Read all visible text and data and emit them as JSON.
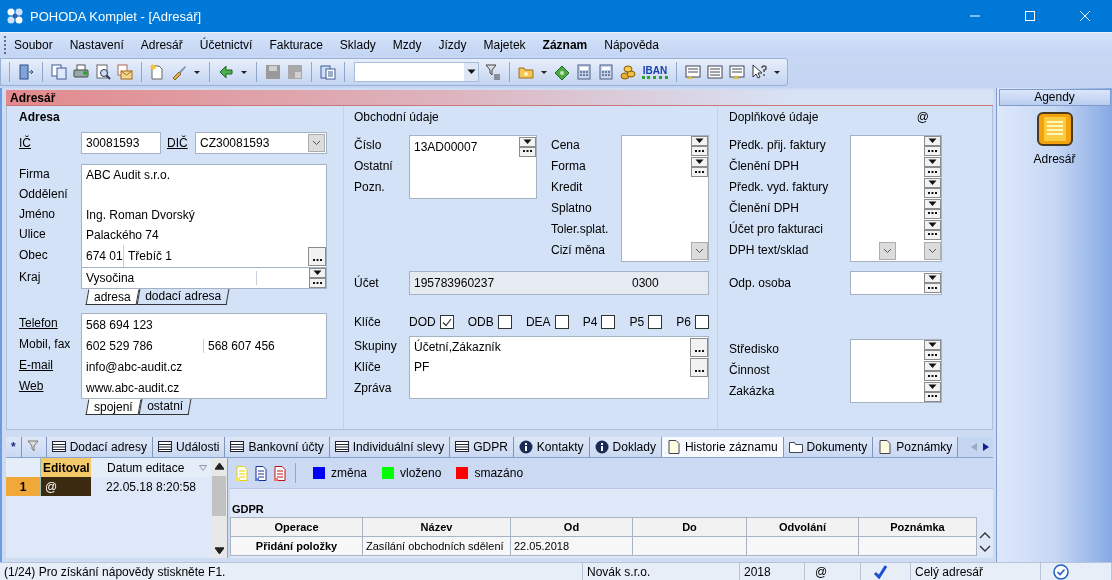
{
  "window": {
    "title": "POHODA Komplet - [Adresář]"
  },
  "menu": [
    {
      "label": "Soubor",
      "bold": false
    },
    {
      "label": "Nastavení",
      "bold": false
    },
    {
      "label": "Adresář",
      "bold": false
    },
    {
      "label": "Účetnictví",
      "bold": false
    },
    {
      "label": "Fakturace",
      "bold": false
    },
    {
      "label": "Sklady",
      "bold": false
    },
    {
      "label": "Mzdy",
      "bold": false
    },
    {
      "label": "Jízdy",
      "bold": false
    },
    {
      "label": "Majetek",
      "bold": false
    },
    {
      "label": "Záznam",
      "bold": true
    },
    {
      "label": "Nápověda",
      "bold": false
    }
  ],
  "toolbar": {
    "iban_label": "IBAN"
  },
  "agenda": {
    "title": "Adresář"
  },
  "address": {
    "title": "Adresa",
    "ic_label": "IČ",
    "ic": "30081593",
    "dic_label": "DIČ",
    "dic": "CZ30081593",
    "rows": [
      {
        "label": "Firma",
        "value": "ABC Audit s.r.o."
      },
      {
        "label": "Oddělení"
      },
      {
        "label": "Jméno",
        "value": "Ing. Roman Dvorský"
      },
      {
        "label": "Ulice",
        "value": "Palackého 74"
      }
    ],
    "city": {
      "label": "Obec",
      "zip": "674 01",
      "value": "Třebíč 1"
    },
    "region": {
      "label": "Kraj",
      "value": "Vysočina"
    },
    "tabs": [
      {
        "label": "adresa",
        "selected": true
      },
      {
        "label": "dodací adresa",
        "selected": false
      }
    ],
    "contact_rows": [
      {
        "label": "Telefon",
        "underlined": true,
        "value": "568 694 123"
      },
      {
        "label": "Mobil, fax",
        "underlined": false,
        "value": "602 529 786",
        "value_2": "568 607 456"
      },
      {
        "label": "E-mail",
        "underlined": true,
        "value": "info@abc-audit.cz"
      },
      {
        "label": "Web",
        "underlined": true,
        "value": "www.abc-audit.cz"
      }
    ],
    "contact_tabs": [
      {
        "label": "spojení",
        "selected": true
      },
      {
        "label": "ostatní",
        "selected": false
      }
    ]
  },
  "business": {
    "title": "Obchodní údaje",
    "number_labels": [
      "Číslo",
      "Ostatní",
      "Pozn."
    ],
    "number": "13AD00007",
    "price_labels": [
      "Cena",
      "Forma",
      "Kredit",
      "Splatno",
      "Toler.splat.",
      "Cizí měna"
    ],
    "account_label": "Účet",
    "account": "195783960237",
    "bank_code": "0300",
    "keys_label": "Klíče",
    "checks": [
      {
        "label": "DOD",
        "checked": true
      },
      {
        "label": "ODB",
        "checked": false
      },
      {
        "label": "DEA",
        "checked": false
      },
      {
        "label": "P4",
        "checked": false
      },
      {
        "label": "P5",
        "checked": false
      },
      {
        "label": "P6",
        "checked": false
      }
    ],
    "group_rows": [
      {
        "label": "Skupiny",
        "value": "Účetní,Zákazník"
      },
      {
        "label": "Klíče",
        "value": "PF"
      },
      {
        "label": "Zpráva"
      }
    ]
  },
  "extra": {
    "title": "Doplňkové údaje",
    "at": "@",
    "rows": [
      "Předk. přij. faktury",
      "Členění DPH",
      "Předk. vyd. faktury",
      "Členění DPH",
      "Účet pro fakturaci",
      "DPH text/sklad"
    ],
    "person_label": "Odp. osoba",
    "centre_labels": [
      "Středisko",
      "Činnost",
      "Zakázka"
    ]
  },
  "agendy": {
    "title": "Agendy",
    "items": [
      {
        "label": "Adresář"
      }
    ]
  },
  "tabs": [
    {
      "kind": "star",
      "label": "*",
      "selected": false
    },
    {
      "kind": "filter",
      "selected": false
    },
    {
      "kind": "table",
      "label": "Dodací adresy",
      "selected": false
    },
    {
      "kind": "table",
      "label": "Události",
      "selected": false
    },
    {
      "kind": "table",
      "label": "Bankovní účty",
      "selected": false
    },
    {
      "kind": "table",
      "label": "Individuální slevy",
      "selected": false
    },
    {
      "kind": "table",
      "label": "GDPR",
      "selected": false
    },
    {
      "kind": "info",
      "label": "Kontakty",
      "selected": false
    },
    {
      "kind": "info",
      "label": "Doklady",
      "selected": false
    },
    {
      "kind": "page",
      "label": "Historie záznamu",
      "selected": true
    },
    {
      "kind": "folder",
      "label": "Dokumenty",
      "selected": false
    },
    {
      "kind": "page",
      "label": "Poznámky",
      "selected": false
    }
  ],
  "history": {
    "legend": [
      {
        "label": "změna",
        "color": "#0000ff"
      },
      {
        "label": "vloženo",
        "color": "#00ff00"
      },
      {
        "label": "smazáno",
        "color": "#ff0000"
      }
    ],
    "list": {
      "columns": [
        "Editoval",
        "Datum editace"
      ],
      "rows": [
        {
          "number": "1",
          "selected": true,
          "user": "@",
          "date": "22.05.18 8:20:58"
        }
      ]
    },
    "detail": {
      "title": "GDPR",
      "columns": [
        "Operace",
        "Název",
        "Od",
        "Do",
        "Odvolání",
        "Poznámka"
      ],
      "rows": [
        {
          "cells": [
            "Přidání položky",
            "Zasílání obchodních sdělení",
            "22.05.2018"
          ]
        }
      ]
    }
  },
  "status_bar": {
    "help": "(1/24) Pro získání nápovědy stiskněte F1.",
    "company": "Novák s.r.o.",
    "year": "2018",
    "user": "@",
    "filter": "Celý adresář"
  }
}
